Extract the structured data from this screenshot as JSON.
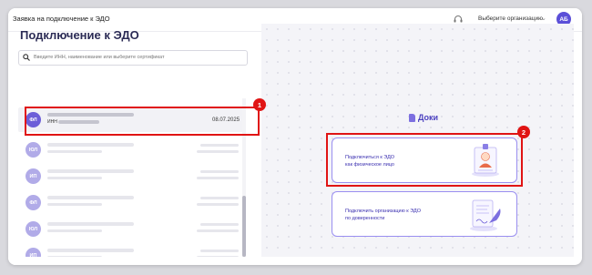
{
  "window": {
    "title": "Заявка на подключение к ЭДО"
  },
  "header": {
    "org_select_label": "Выберите организацию",
    "avatar_initials": "АБ"
  },
  "left": {
    "title": "Подключение к ЭДО",
    "search": {
      "placeholder": "Введите ИНН, наименование или выберите сертификат",
      "value": ""
    },
    "selected_cert": {
      "badge": "ФЛ",
      "inn_label": "ИНН",
      "date": "08.07.2025"
    },
    "other_certs": [
      {
        "badge": "ЮЛ"
      },
      {
        "badge": "ИП"
      },
      {
        "badge": "ФЛ"
      },
      {
        "badge": "ЮЛ"
      },
      {
        "badge": "ИП"
      }
    ]
  },
  "right": {
    "brand": "Доки",
    "option_individual": {
      "line1": "Подключиться к ЭДО",
      "line2": "как физическое лицо"
    },
    "option_org": {
      "line1": "Подключить организацию к ЭДО",
      "line2": "по доверенности"
    }
  },
  "annotations": {
    "marker1": "1",
    "marker2": "2"
  },
  "colors": {
    "accent": "#5b4fd8",
    "highlight": "#e01414"
  }
}
